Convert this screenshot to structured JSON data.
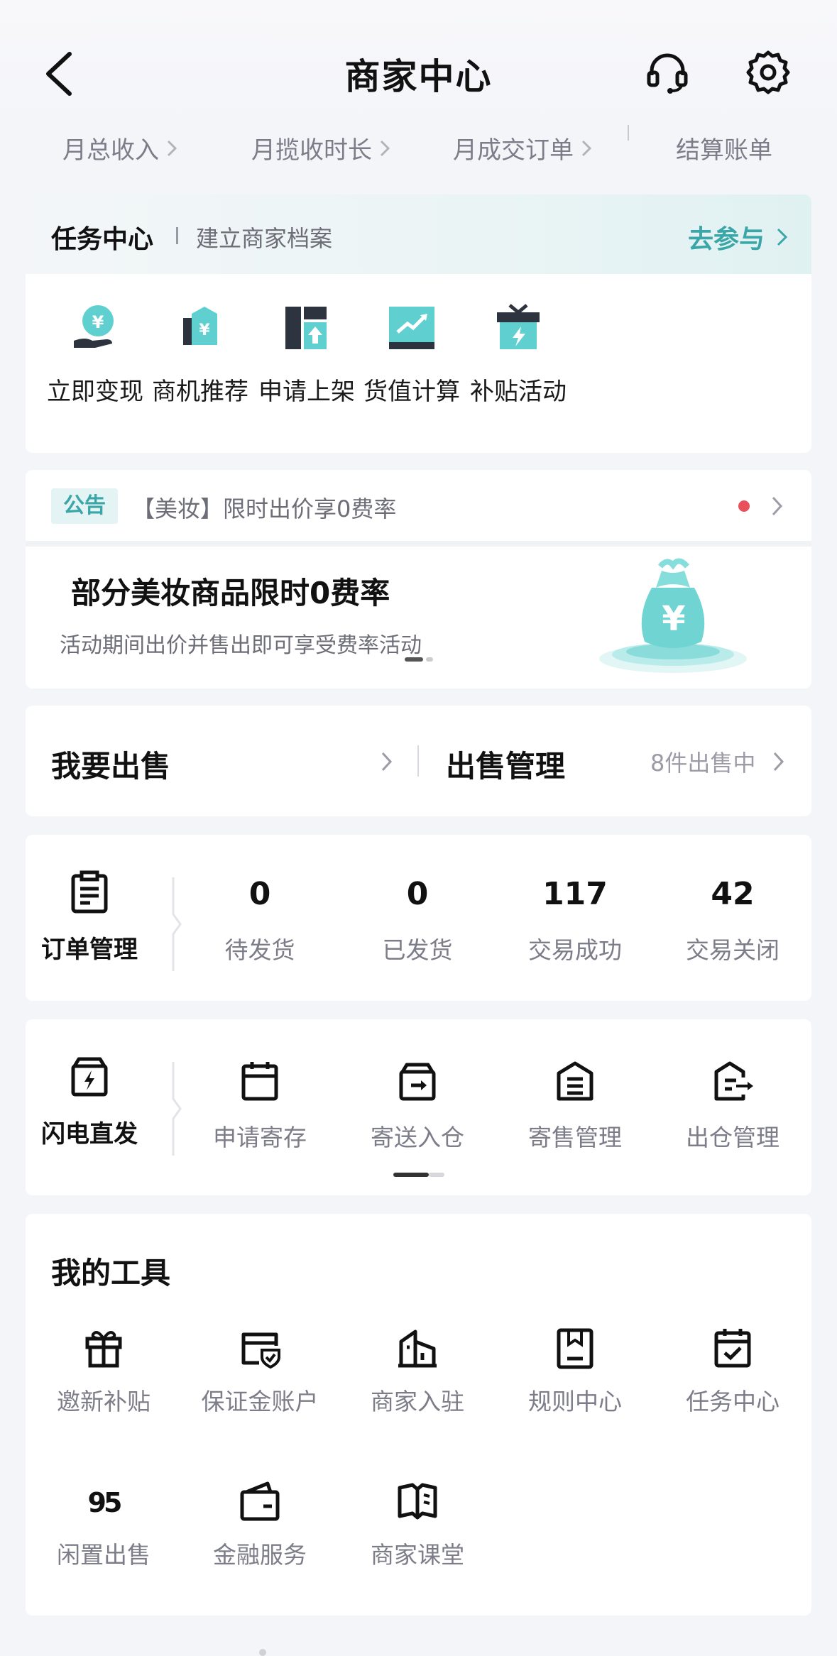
{
  "header": {
    "title": "商家中心",
    "icons": [
      "back-icon",
      "headset-icon",
      "gear-icon"
    ]
  },
  "stats_links": [
    {
      "label": "月总收入"
    },
    {
      "label": "月揽收时长"
    },
    {
      "label": "月成交订单"
    },
    {
      "label": "结算账单"
    }
  ],
  "task_center": {
    "title": "任务中心",
    "subtitle": "建立商家档案",
    "action": "去参与",
    "quick_actions": [
      {
        "label": "立即变现",
        "icon": "cash-hand-icon"
      },
      {
        "label": "商机推荐",
        "icon": "yen-tag-icon"
      },
      {
        "label": "申请上架",
        "icon": "shelf-up-icon"
      },
      {
        "label": "货值计算",
        "icon": "trend-chart-icon"
      },
      {
        "label": "补贴活动",
        "icon": "gift-box-icon"
      }
    ]
  },
  "announcement": {
    "badge": "公告",
    "text": "【美妆】限时出价享0费率",
    "banner_title": "部分美妆商品限时0费率",
    "banner_subtitle": "活动期间出价并售出即可享受费率活动"
  },
  "sell": {
    "left_label": "我要出售",
    "right_label": "出售管理",
    "right_count": "8件出售中"
  },
  "orders": {
    "lead_label": "订单管理",
    "stats": [
      {
        "value": "0",
        "label": "待发货"
      },
      {
        "value": "0",
        "label": "已发货"
      },
      {
        "value": "117",
        "label": "交易成功"
      },
      {
        "value": "42",
        "label": "交易关闭"
      }
    ]
  },
  "flash": {
    "lead_label": "闪电直发",
    "items": [
      {
        "label": "申请寄存",
        "icon": "calendar-icon"
      },
      {
        "label": "寄送入仓",
        "icon": "box-in-icon"
      },
      {
        "label": "寄售管理",
        "icon": "consign-doc-icon"
      },
      {
        "label": "出仓管理",
        "icon": "warehouse-out-icon"
      }
    ]
  },
  "tools": {
    "title": "我的工具",
    "items": [
      {
        "label": "邀新补贴",
        "icon": "gift-icon"
      },
      {
        "label": "保证金账户",
        "icon": "deposit-card-icon"
      },
      {
        "label": "商家入驻",
        "icon": "building-icon"
      },
      {
        "label": "规则中心",
        "icon": "rules-book-icon"
      },
      {
        "label": "任务中心",
        "icon": "task-calendar-icon"
      },
      {
        "label": "闲置出售",
        "icon": "95-logo-icon"
      },
      {
        "label": "金融服务",
        "icon": "wallet-icon"
      },
      {
        "label": "商家课堂",
        "icon": "open-book-icon"
      }
    ]
  },
  "colors": {
    "accent": "#3aa6a8",
    "background": "#f4f5f9",
    "card": "#ffffff",
    "notice_dot": "#e9505a"
  }
}
